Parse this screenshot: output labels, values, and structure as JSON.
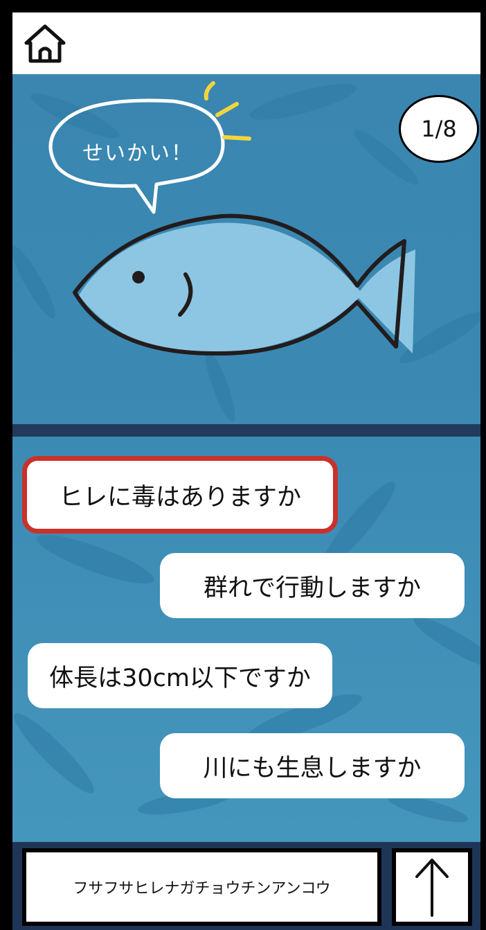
{
  "header": {
    "home_icon": "home-icon"
  },
  "progress": {
    "label": "1/8",
    "current": 1,
    "total": 8
  },
  "feedback": {
    "speech": "せいかい！"
  },
  "questions": [
    {
      "label": "ヒレに毒はありますか",
      "selected": true
    },
    {
      "label": "群れで行動しますか",
      "selected": false
    },
    {
      "label": "体長は30cm以下ですか",
      "selected": false
    },
    {
      "label": "川にも生息しますか",
      "selected": false
    }
  ],
  "answer": {
    "text": "フサフサヒレナガチョウチンアンコウ"
  },
  "submit": {
    "icon": "arrow-up-icon"
  },
  "colors": {
    "sea": "#3b89b3",
    "divider": "#233a5c",
    "selected_border": "#c9322b",
    "fish_fill": "#8dc6e3",
    "accent_yellow": "#f2d53c"
  }
}
